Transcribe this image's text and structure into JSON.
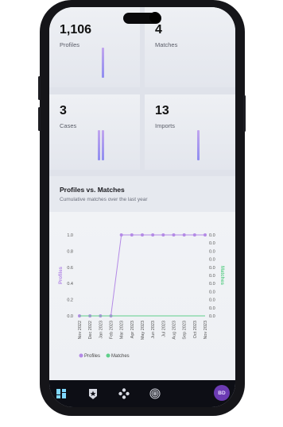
{
  "stats": [
    {
      "value": "1,106",
      "label": "Profiles"
    },
    {
      "value": "4",
      "label": "Matches"
    },
    {
      "value": "3",
      "label": "Cases"
    },
    {
      "value": "13",
      "label": "Imports"
    }
  ],
  "chart_panel": {
    "title": "Profiles vs. Matches",
    "subtitle": "Cumulative matches over the last year"
  },
  "chart_data": {
    "type": "line",
    "title": "Profiles vs. Matches",
    "x": [
      "Nov 2022",
      "Dec 2022",
      "Jan 2023",
      "Feb 2023",
      "Mar 2023",
      "Apr 2023",
      "May 2023",
      "Jun 2023",
      "Jul 2023",
      "Aug 2023",
      "Sep 2023",
      "Oct 2023",
      "Nov 2023"
    ],
    "series": [
      {
        "name": "Profiles",
        "axis": "left",
        "values": [
          0,
          0,
          0,
          0,
          1,
          1,
          1,
          1,
          1,
          1,
          1,
          1,
          1
        ]
      },
      {
        "name": "Matches",
        "axis": "right",
        "values": [
          0,
          0,
          0,
          0,
          0,
          0,
          0,
          0,
          0,
          0,
          0,
          0,
          0
        ]
      }
    ],
    "ylabel_left": "Profiles",
    "ylabel_right": "Matches",
    "yticks_left": [
      "1.0",
      "0.8",
      "0.6",
      "0.4",
      "0.2",
      "0.0"
    ],
    "yticks_right": [
      "0.0",
      "0.0",
      "0.0",
      "0.0",
      "0.0",
      "0.0",
      "0.0",
      "0.0",
      "0.0",
      "0.0",
      "0.0"
    ],
    "ylim": [
      0,
      1
    ],
    "legend": "bottom",
    "colors": {
      "Profiles": "#b48ae6",
      "Matches": "#5fcf8a"
    }
  },
  "nav": {
    "items": [
      "dashboard-icon",
      "star-badge-icon",
      "network-icon",
      "fingerprint-icon"
    ],
    "active": "dashboard-icon",
    "avatar_initials": "BD"
  },
  "colors": {
    "accent": "#9b7be8",
    "nav_bg": "#0d0e15",
    "avatar": "#6c3bb3"
  }
}
